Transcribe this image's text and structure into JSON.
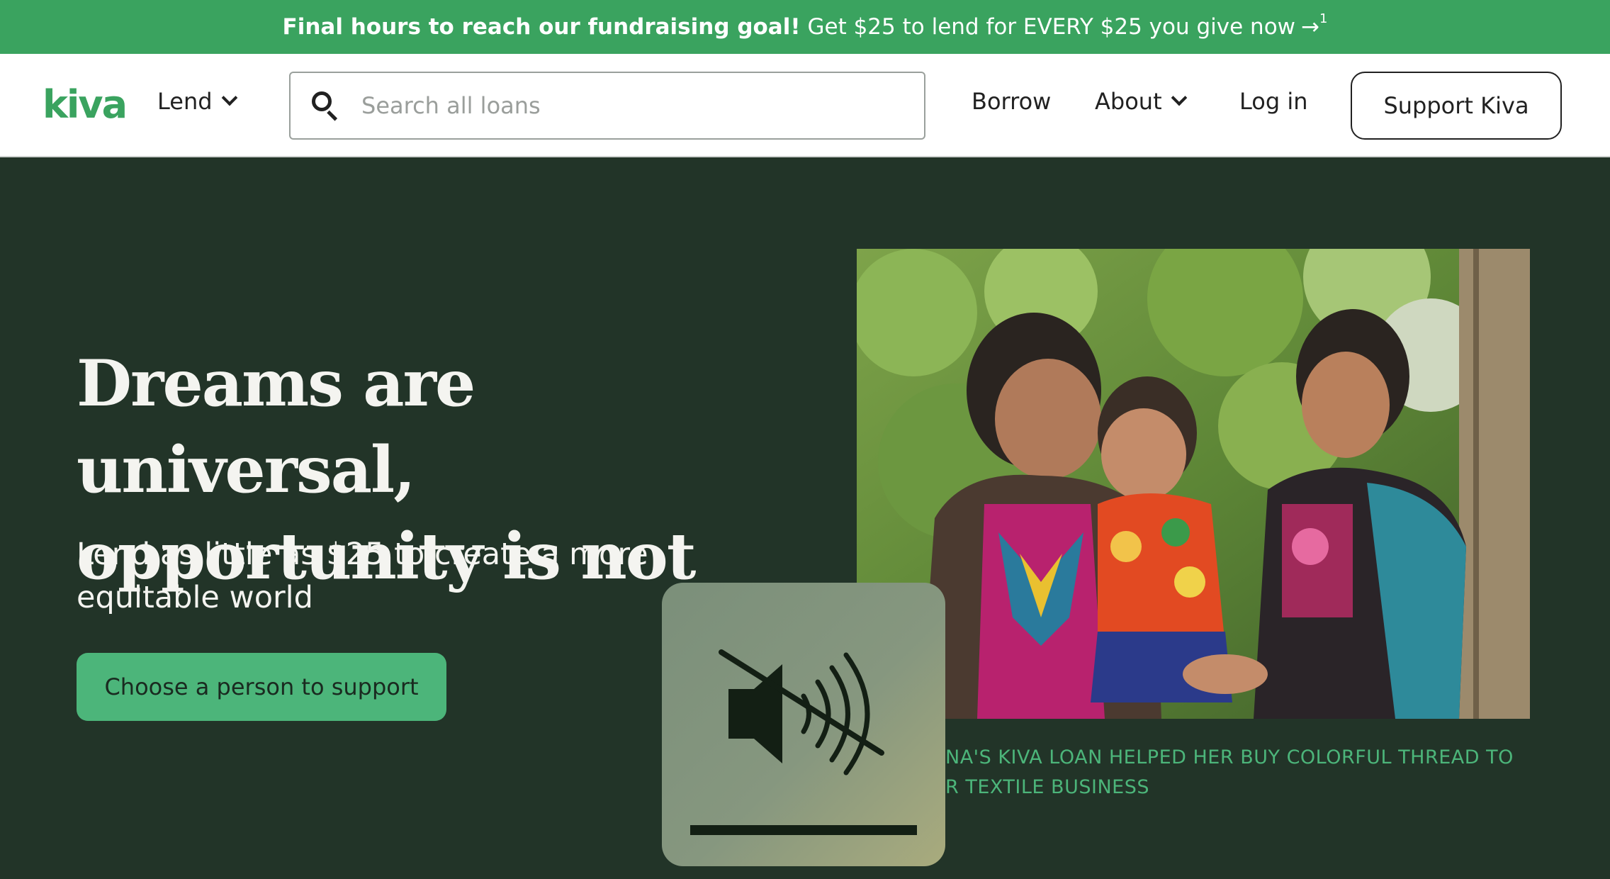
{
  "promo": {
    "bold_text": "Final hours to reach our fundraising goal!",
    "text": "Get $25 to lend for EVERY $25 you give now",
    "arrow": "→",
    "footnote": "1"
  },
  "header": {
    "logo": "kiva",
    "lend_label": "Lend",
    "search_placeholder": "Search all loans",
    "borrow_label": "Borrow",
    "about_label": "About",
    "login_label": "Log in",
    "support_label": "Support Kiva"
  },
  "hero": {
    "title_line1": "Dreams are universal,",
    "title_line2": "opportunity is not",
    "subtitle": "Lend as little as $25 to create a more equitable world",
    "cta_label": "Choose a person to support",
    "caption_line1": "NA'S KIVA LOAN HELPED HER BUY COLORFUL THREAD TO",
    "caption_line2": "R TEXTILE BUSINESS"
  },
  "media": {
    "mute_icon": "speaker-muted-icon"
  },
  "colors": {
    "brand_green": "#3aa35f",
    "cta_green": "#4cb57a",
    "hero_bg": "#223428"
  }
}
